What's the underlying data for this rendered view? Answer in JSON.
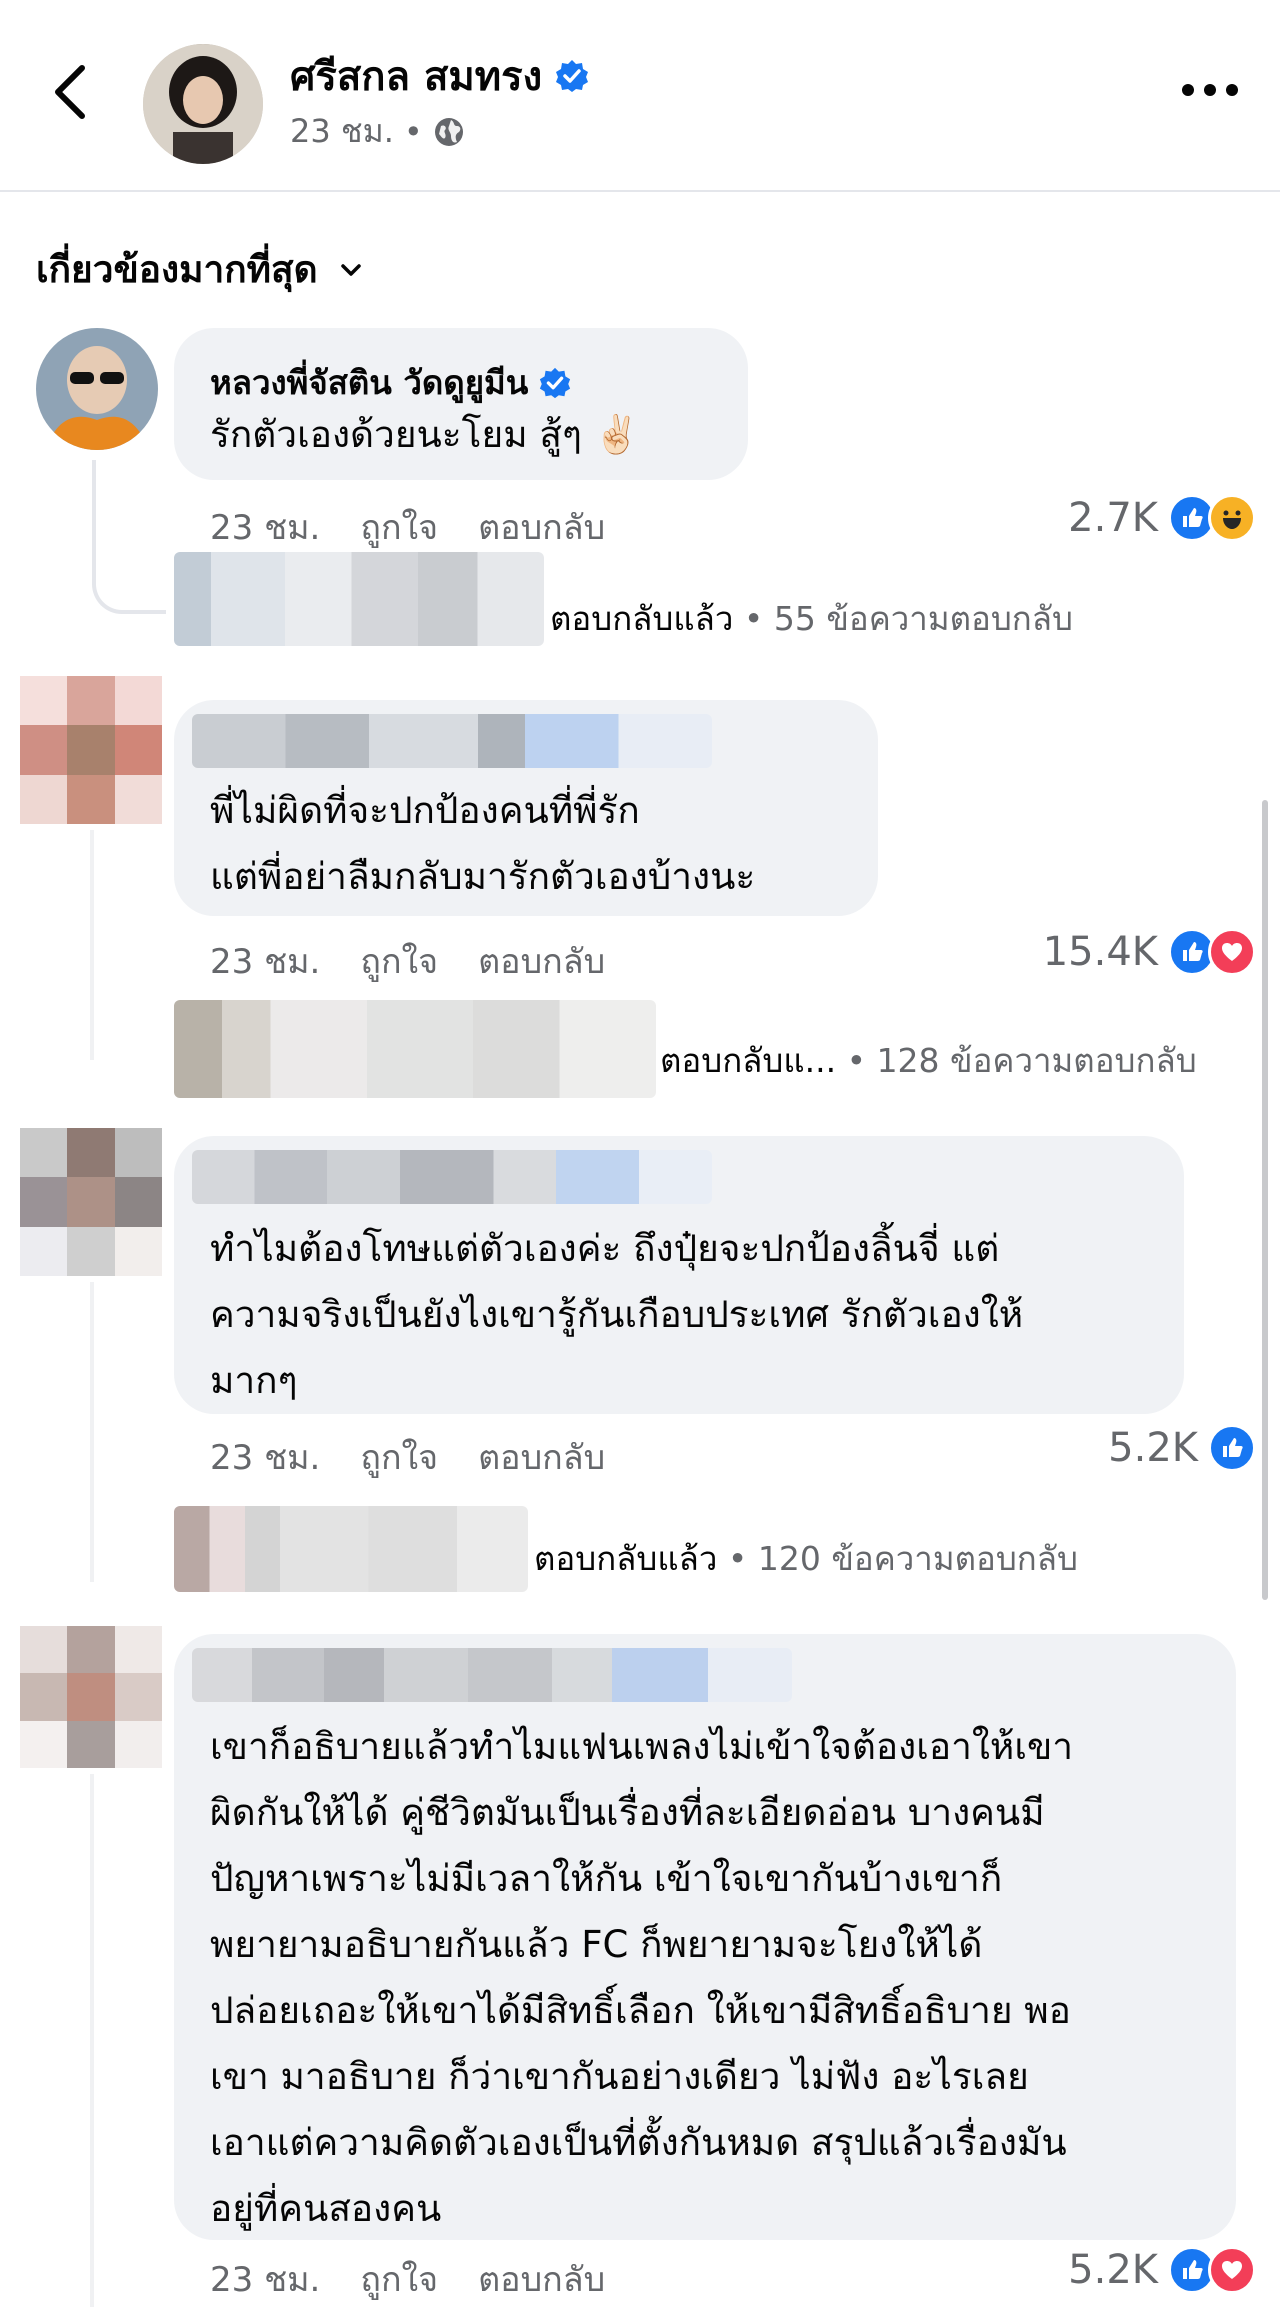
{
  "post": {
    "author": "ศรีสกล สมทรง",
    "time": "23 ชม.",
    "dot": "•"
  },
  "sort_label": "เกี่ยวข้องมากที่สุด",
  "comments": [
    {
      "name": "หลวงพี่จัสติน วัดดูยูมีน",
      "text_lines": [
        "รักตัวเองด้วยนะโยม สู้ๆ ✌🏻"
      ],
      "time": "23 ชม.",
      "like": "ถูกใจ",
      "reply": "ตอบกลับ",
      "count": "2.7K",
      "replies_tag": "ตอบกลับแล้ว",
      "replies_count": "55 ข้อความตอบกลับ"
    },
    {
      "name": "",
      "text_lines": [
        "พี่ไม่ผิดที่จะปกป้องคนที่พี่รัก",
        "แต่พี่อย่าลืมกลับมารักตัวเองบ้างนะ"
      ],
      "time": "23 ชม.",
      "like": "ถูกใจ",
      "reply": "ตอบกลับ",
      "count": "15.4K",
      "replies_tag": "ตอบกลับแ...",
      "replies_count": "128 ข้อความตอบกลับ"
    },
    {
      "name": "",
      "text_lines": [
        "ทำไมต้องโทษแต่ตัวเองค่ะ ถึงปุ๋ยจะปกป้องลิ้นจี่ แต่",
        "ความจริงเป็นยังไงเขารู้กันเกือบประเทศ รักตัวเองให้",
        "มากๆ"
      ],
      "time": "23 ชม.",
      "like": "ถูกใจ",
      "reply": "ตอบกลับ",
      "count": "5.2K",
      "replies_tag": "ตอบกลับแล้ว",
      "replies_count": "120 ข้อความตอบกลับ"
    },
    {
      "name": "",
      "text_lines": [
        "เขาก็อธิบายแล้วทำไมแฟนเพลงไม่เข้าใจต้องเอาให้เขา",
        "ผิดกันให้ได้ คู่ชีวิตมันเป็นเรื่องที่ละเอียดอ่อน บางคนมี",
        "ปัญหาเพราะไม่มีเวลาให้กัน เข้าใจเขากันบ้างเขาก็",
        "พยายามอธิบายกันแล้ว FC ก็พยายามจะโยงให้ได้",
        "ปล่อยเถอะให้เขาได้มีสิทธิ์เลือก ให้เขามีสิทธิ์อธิบาย พอ",
        "เขา มาอธิบาย  ก็ว่าเขากันอย่างเดียว ไม่ฟัง อะไรเลย",
        "เอาแต่ความคิดตัวเองเป็นที่ตั้งกันหมด สรุปแล้วเรื่องมัน",
        "อยู่ที่คนสองคน"
      ],
      "time": "23 ชม.",
      "like": "ถูกใจ",
      "reply": "ตอบกลับ",
      "count": "5.2K"
    }
  ],
  "colors": {
    "like": "#1877f2",
    "love": "#f33e58",
    "haha": "#f7b125",
    "verified": "#1877f2"
  }
}
